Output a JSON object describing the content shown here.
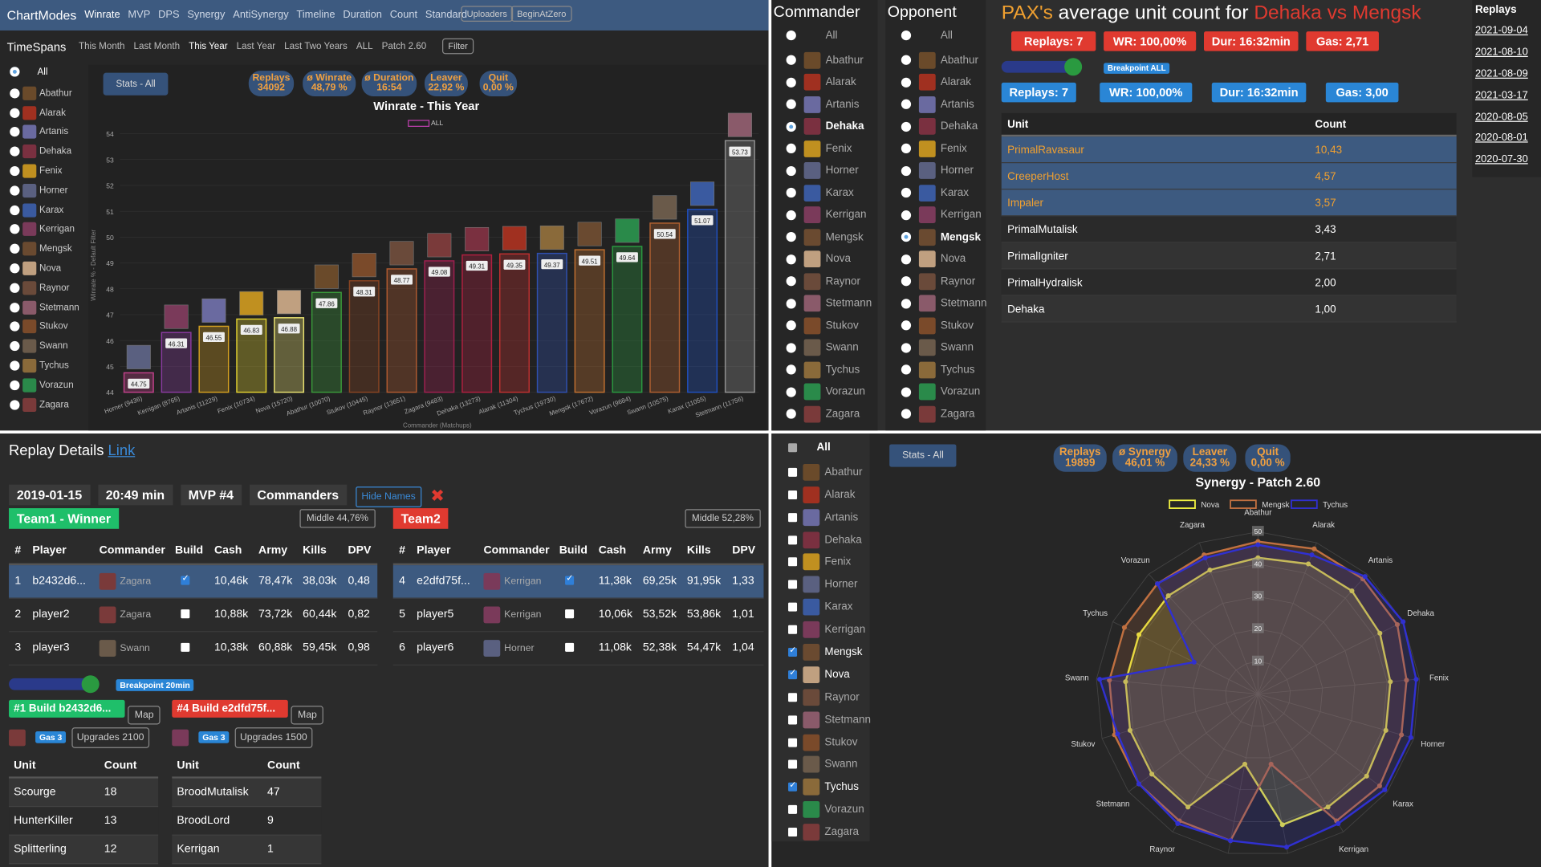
{
  "colors": {
    "orange": "#f0a030",
    "red": "#e03a30",
    "blue": "#2a86d6",
    "green": "#1fbf6a",
    "darkblue": "#35527a",
    "panel": "#2b2b2b"
  },
  "nav": {
    "brand": "ChartModes",
    "modes": [
      "Winrate",
      "MVP",
      "DPS",
      "Synergy",
      "AntiSynergy",
      "Timeline",
      "Duration",
      "Count",
      "Standard"
    ],
    "buttons": [
      "Uploaders",
      "BeginAtZero"
    ]
  },
  "timespans": {
    "label": "TimeSpans",
    "items": [
      "This Month",
      "Last Month",
      "This Year",
      "Last Year",
      "Last Two Years",
      "ALL",
      "Patch 2.60"
    ],
    "filter": "Filter"
  },
  "commanders": [
    "All",
    "Abathur",
    "Alarak",
    "Artanis",
    "Dehaka",
    "Fenix",
    "Horner",
    "Karax",
    "Kerrigan",
    "Mengsk",
    "Nova",
    "Raynor",
    "Stetmann",
    "Stukov",
    "Swann",
    "Tychus",
    "Vorazun",
    "Zagara"
  ],
  "winrate": {
    "stats_button": "Stats - All",
    "pills": [
      {
        "label": "Replays",
        "value": "34092"
      },
      {
        "label": "ø Winrate",
        "value": "48,79 %"
      },
      {
        "label": "ø Duration",
        "value": "16:54"
      },
      {
        "label": "Leaver",
        "value": "22,92 %"
      },
      {
        "label": "Quit",
        "value": "0,00 %"
      }
    ],
    "chart_data": {
      "type": "bar",
      "title": "Winrate - This Year",
      "legend": "ALL",
      "ylabel": "Winrate % - Default Filter",
      "xlabel": "Commander (Matchups)",
      "ylim": [
        44,
        54
      ],
      "yticks": [
        "54",
        "53",
        "52",
        "51",
        "50",
        "49",
        "48",
        "47",
        "46",
        "45",
        "44"
      ],
      "categories": [
        "Horner (9436)",
        "Kerrigan (8765)",
        "Artanis (11229)",
        "Fenix (10734)",
        "Nova (15720)",
        "Abathur (10070)",
        "Stukov (10445)",
        "Raynor (13651)",
        "Zagara (9483)",
        "Dehaka (13273)",
        "Alarak (11304)",
        "Tychus (19730)",
        "Mengsk (17672)",
        "Vorazun (9684)",
        "Swann (10575)",
        "Karax (11055)",
        "Stetmann (11756)"
      ],
      "values": [
        44.75,
        46.31,
        46.55,
        46.83,
        46.88,
        47.86,
        48.31,
        48.77,
        49.08,
        49.31,
        49.35,
        49.37,
        49.51,
        49.64,
        50.54,
        51.07,
        53.73
      ],
      "labels": [
        "44.75",
        "46.31",
        "46.55",
        "46.83",
        "46.88",
        "47.86",
        "48.31",
        "48.77",
        "49.08",
        "49.31",
        "49.35",
        "49.37",
        "49.51",
        "49.64",
        "50.54",
        "51.07",
        "53.73"
      ],
      "colors": [
        "#c0408a",
        "#8a3aa0",
        "#d4a020",
        "#e0d030",
        "#e8e070",
        "#3a9a3a",
        "#884422",
        "#b05a30",
        "#a02050",
        "#b02040",
        "#c03030",
        "#3050b0",
        "#c07030",
        "#2a9a40",
        "#b06030",
        "#2050c0",
        "#909090"
      ]
    }
  },
  "unitcount": {
    "commander_header": "Commander",
    "opponent_header": "Opponent",
    "selected_commander": "Dehaka",
    "selected_opponent": "Mengsk",
    "title_prefix": "PAX's",
    "title_mid": " average unit count for ",
    "title_matchup": "Dehaka vs Mengsk",
    "red_badges": [
      "Replays: 7",
      "WR: 100,00%",
      "Dur: 16:32min",
      "Gas: 2,71"
    ],
    "breakpoint": "Breakpoint ALL",
    "blue_badges": [
      "Replays: 7",
      "WR: 100,00%",
      "Dur: 16:32min",
      "Gas: 3,00"
    ],
    "table_headers": [
      "Unit",
      "Count"
    ],
    "rows": [
      {
        "unit": "PrimalRavasaur",
        "count": "10,43",
        "hl": true
      },
      {
        "unit": "CreeperHost",
        "count": "4,57",
        "hl": true
      },
      {
        "unit": "Impaler",
        "count": "3,57",
        "hl": true
      },
      {
        "unit": "PrimalMutalisk",
        "count": "3,43",
        "hl": false
      },
      {
        "unit": "PrimalIgniter",
        "count": "2,71",
        "hl": false
      },
      {
        "unit": "PrimalHydralisk",
        "count": "2,00",
        "hl": false
      },
      {
        "unit": "Dehaka",
        "count": "1,00",
        "hl": false
      }
    ],
    "replays_header": "Replays",
    "replay_dates": [
      "2021-09-04",
      "2021-08-10",
      "2021-08-09",
      "2021-03-17",
      "2020-08-05",
      "2020-08-01",
      "2020-07-30"
    ]
  },
  "replay": {
    "header": "Replay Details",
    "link": "Link",
    "date": "2019-01-15",
    "duration": "20:49 min",
    "mvp": "MVP #4",
    "commanders_btn": "Commanders",
    "hide_names": "Hide Names",
    "close": "✖",
    "team1": {
      "label": "Team1 - Winner",
      "middle": "Middle 44,76%"
    },
    "team2": {
      "label": "Team2",
      "middle": "Middle 52,28%"
    },
    "headers": [
      "#",
      "Player",
      "Commander",
      "Build",
      "Cash",
      "Army",
      "Kills",
      "DPV"
    ],
    "team1_rows": [
      {
        "n": "1",
        "player": "b2432d6...",
        "cmdr": "Zagara",
        "build": true,
        "cash": "10,46k",
        "army": "78,47k",
        "kills": "38,03k",
        "dpv": "0,48",
        "sel": true
      },
      {
        "n": "2",
        "player": "player2",
        "cmdr": "Zagara",
        "build": false,
        "cash": "10,88k",
        "army": "73,72k",
        "kills": "60,44k",
        "dpv": "0,82",
        "sel": false
      },
      {
        "n": "3",
        "player": "player3",
        "cmdr": "Swann",
        "build": false,
        "cash": "10,38k",
        "army": "60,88k",
        "kills": "59,45k",
        "dpv": "0,98",
        "sel": false
      }
    ],
    "team2_rows": [
      {
        "n": "4",
        "player": "e2dfd75f...",
        "cmdr": "Kerrigan",
        "build": true,
        "cash": "11,38k",
        "army": "69,25k",
        "kills": "91,95k",
        "dpv": "1,33",
        "sel": true
      },
      {
        "n": "5",
        "player": "player5",
        "cmdr": "Kerrigan",
        "build": false,
        "cash": "10,06k",
        "army": "53,52k",
        "kills": "53,86k",
        "dpv": "1,01",
        "sel": false
      },
      {
        "n": "6",
        "player": "player6",
        "cmdr": "Horner",
        "build": false,
        "cash": "11,08k",
        "army": "52,38k",
        "kills": "54,47k",
        "dpv": "1,04",
        "sel": false
      }
    ],
    "breakpoint": "Breakpoint 20min",
    "build1": {
      "title": "#1 Build b2432d6...",
      "map": "Map",
      "gas": "Gas 3",
      "upgrades": "Upgrades 2100",
      "rows": [
        [
          "Scourge",
          "18"
        ],
        [
          "HunterKiller",
          "13"
        ],
        [
          "Splitterling",
          "12"
        ]
      ]
    },
    "build2": {
      "title": "#4 Build e2dfd75f...",
      "map": "Map",
      "gas": "Gas 3",
      "upgrades": "Upgrades 1500",
      "rows": [
        [
          "BroodMutalisk",
          "47"
        ],
        [
          "BroodLord",
          "9"
        ],
        [
          "Kerrigan",
          "1"
        ]
      ]
    },
    "unit_headers": [
      "Unit",
      "Count"
    ]
  },
  "synergy": {
    "checked": [
      "Mengsk",
      "Nova",
      "Tychus"
    ],
    "stats_button": "Stats - All",
    "pills": [
      {
        "label": "Replays",
        "value": "19899"
      },
      {
        "label": "ø Synergy",
        "value": "46,01 %"
      },
      {
        "label": "Leaver",
        "value": "24,33 %"
      },
      {
        "label": "Quit",
        "value": "0,00 %"
      }
    ],
    "chart_data": {
      "type": "radar",
      "title": "Synergy - Patch 2.60",
      "axes": [
        "Abathur",
        "Alarak",
        "Artanis",
        "Dehaka",
        "Fenix",
        "Horner",
        "Karax",
        "Kerrigan",
        "Mengsk",
        "Nova",
        "Raynor",
        "Stetmann",
        "Stukov",
        "Swann",
        "Tychus",
        "Vorazun",
        "Zagara"
      ],
      "ticks": [
        "10",
        "20",
        "30",
        "40",
        "50"
      ],
      "max": 50,
      "series": [
        {
          "name": "Nova",
          "color": "#f0f040",
          "values": [
            42,
            43,
            43,
            42,
            41,
            41,
            42,
            41,
            41,
            0,
            41,
            41,
            41,
            41,
            41,
            41,
            41
          ]
        },
        {
          "name": "Mengsk",
          "color": "#c07040",
          "values": [
            47,
            48,
            48,
            48,
            46,
            46,
            47,
            46,
            0,
            46,
            46,
            46,
            46,
            46,
            46,
            46,
            46
          ]
        },
        {
          "name": "Tychus",
          "color": "#3030d0",
          "values": [
            46,
            46,
            49,
            50,
            49,
            49,
            49,
            47,
            48,
            46,
            47,
            46,
            45,
            49,
            0,
            46,
            45
          ]
        }
      ]
    }
  }
}
